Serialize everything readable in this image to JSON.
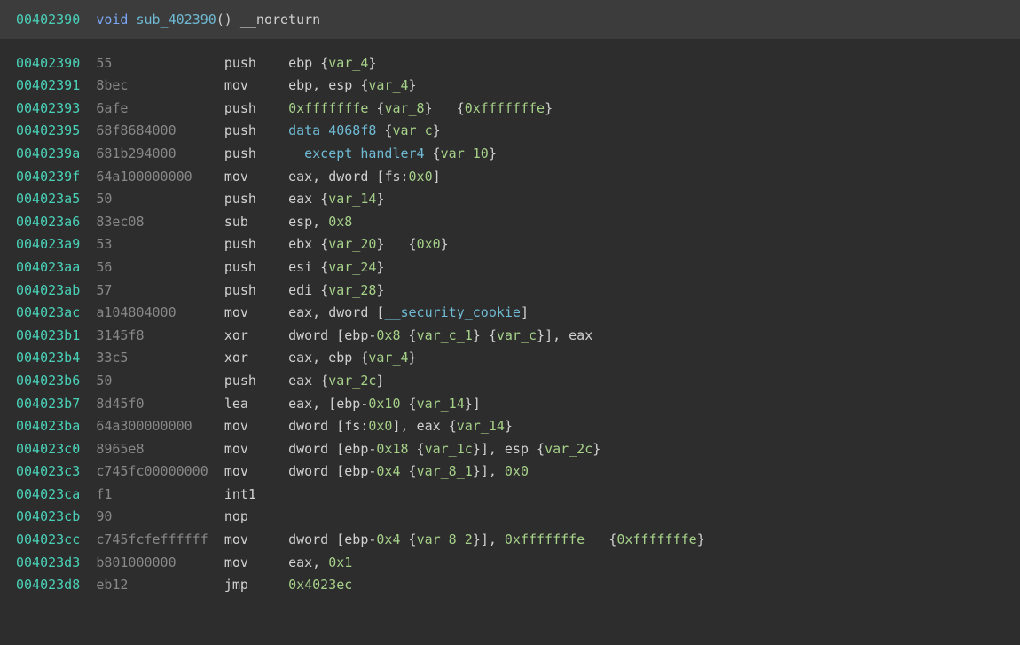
{
  "header": {
    "addr": "00402390",
    "ret_type": "void",
    "name": "sub_402390",
    "parens": "()",
    "attr": "__noreturn"
  },
  "rows": [
    {
      "addr": "00402390",
      "bytes": "55",
      "mnemo": "push",
      "ops": [
        {
          "t": "reg",
          "v": "ebp"
        },
        {
          "t": "sp"
        },
        {
          "t": "brace",
          "v": "{"
        },
        {
          "t": "var",
          "v": "var_4"
        },
        {
          "t": "brace",
          "v": "}"
        }
      ]
    },
    {
      "addr": "00402391",
      "bytes": "8bec",
      "mnemo": "mov",
      "ops": [
        {
          "t": "reg",
          "v": "ebp"
        },
        {
          "t": "punct",
          "v": ", "
        },
        {
          "t": "reg",
          "v": "esp"
        },
        {
          "t": "sp"
        },
        {
          "t": "brace",
          "v": "{"
        },
        {
          "t": "var",
          "v": "var_4"
        },
        {
          "t": "brace",
          "v": "}"
        }
      ]
    },
    {
      "addr": "00402393",
      "bytes": "6afe",
      "mnemo": "push",
      "ops": [
        {
          "t": "num",
          "v": "0xfffffffe"
        },
        {
          "t": "sp"
        },
        {
          "t": "brace",
          "v": "{"
        },
        {
          "t": "var",
          "v": "var_8"
        },
        {
          "t": "brace",
          "v": "}"
        },
        {
          "t": "sp3"
        },
        {
          "t": "brace",
          "v": "{"
        },
        {
          "t": "num",
          "v": "0xfffffffe"
        },
        {
          "t": "brace",
          "v": "}"
        }
      ]
    },
    {
      "addr": "00402395",
      "bytes": "68f8684000",
      "mnemo": "push",
      "ops": [
        {
          "t": "sym",
          "v": "data_4068f8"
        },
        {
          "t": "sp"
        },
        {
          "t": "brace",
          "v": "{"
        },
        {
          "t": "var",
          "v": "var_c"
        },
        {
          "t": "brace",
          "v": "}"
        }
      ]
    },
    {
      "addr": "0040239a",
      "bytes": "681b294000",
      "mnemo": "push",
      "ops": [
        {
          "t": "sym",
          "v": "__except_handler4"
        },
        {
          "t": "sp"
        },
        {
          "t": "brace",
          "v": "{"
        },
        {
          "t": "var",
          "v": "var_10"
        },
        {
          "t": "brace",
          "v": "}"
        }
      ]
    },
    {
      "addr": "0040239f",
      "bytes": "64a100000000",
      "mnemo": "mov",
      "ops": [
        {
          "t": "reg",
          "v": "eax"
        },
        {
          "t": "punct",
          "v": ", "
        },
        {
          "t": "mem",
          "v": "dword "
        },
        {
          "t": "punct",
          "v": "["
        },
        {
          "t": "reg",
          "v": "fs"
        },
        {
          "t": "punct",
          "v": ":"
        },
        {
          "t": "num",
          "v": "0x0"
        },
        {
          "t": "punct",
          "v": "]"
        }
      ]
    },
    {
      "addr": "004023a5",
      "bytes": "50",
      "mnemo": "push",
      "ops": [
        {
          "t": "reg",
          "v": "eax"
        },
        {
          "t": "sp"
        },
        {
          "t": "brace",
          "v": "{"
        },
        {
          "t": "var",
          "v": "var_14"
        },
        {
          "t": "brace",
          "v": "}"
        }
      ]
    },
    {
      "addr": "004023a6",
      "bytes": "83ec08",
      "mnemo": "sub",
      "ops": [
        {
          "t": "reg",
          "v": "esp"
        },
        {
          "t": "punct",
          "v": ", "
        },
        {
          "t": "num",
          "v": "0x8"
        }
      ]
    },
    {
      "addr": "004023a9",
      "bytes": "53",
      "mnemo": "push",
      "ops": [
        {
          "t": "reg",
          "v": "ebx"
        },
        {
          "t": "sp"
        },
        {
          "t": "brace",
          "v": "{"
        },
        {
          "t": "var",
          "v": "var_20"
        },
        {
          "t": "brace",
          "v": "}"
        },
        {
          "t": "sp3"
        },
        {
          "t": "brace",
          "v": "{"
        },
        {
          "t": "num",
          "v": "0x0"
        },
        {
          "t": "brace",
          "v": "}"
        }
      ]
    },
    {
      "addr": "004023aa",
      "bytes": "56",
      "mnemo": "push",
      "ops": [
        {
          "t": "reg",
          "v": "esi"
        },
        {
          "t": "sp"
        },
        {
          "t": "brace",
          "v": "{"
        },
        {
          "t": "var",
          "v": "var_24"
        },
        {
          "t": "brace",
          "v": "}"
        }
      ]
    },
    {
      "addr": "004023ab",
      "bytes": "57",
      "mnemo": "push",
      "ops": [
        {
          "t": "reg",
          "v": "edi"
        },
        {
          "t": "sp"
        },
        {
          "t": "brace",
          "v": "{"
        },
        {
          "t": "var",
          "v": "var_28"
        },
        {
          "t": "brace",
          "v": "}"
        }
      ]
    },
    {
      "addr": "004023ac",
      "bytes": "a104804000",
      "mnemo": "mov",
      "ops": [
        {
          "t": "reg",
          "v": "eax"
        },
        {
          "t": "punct",
          "v": ", "
        },
        {
          "t": "mem",
          "v": "dword "
        },
        {
          "t": "punct",
          "v": "["
        },
        {
          "t": "sym",
          "v": "__security_cookie"
        },
        {
          "t": "punct",
          "v": "]"
        }
      ]
    },
    {
      "addr": "004023b1",
      "bytes": "3145f8",
      "mnemo": "xor",
      "ops": [
        {
          "t": "mem",
          "v": "dword "
        },
        {
          "t": "punct",
          "v": "["
        },
        {
          "t": "reg",
          "v": "ebp"
        },
        {
          "t": "punct",
          "v": "-"
        },
        {
          "t": "num",
          "v": "0x8"
        },
        {
          "t": "sp"
        },
        {
          "t": "brace",
          "v": "{"
        },
        {
          "t": "var",
          "v": "var_c_1"
        },
        {
          "t": "brace",
          "v": "}"
        },
        {
          "t": "sp"
        },
        {
          "t": "brace",
          "v": "{"
        },
        {
          "t": "var",
          "v": "var_c"
        },
        {
          "t": "brace",
          "v": "}"
        },
        {
          "t": "punct",
          "v": "]"
        },
        {
          "t": "punct",
          "v": ", "
        },
        {
          "t": "reg",
          "v": "eax"
        }
      ]
    },
    {
      "addr": "004023b4",
      "bytes": "33c5",
      "mnemo": "xor",
      "ops": [
        {
          "t": "reg",
          "v": "eax"
        },
        {
          "t": "punct",
          "v": ", "
        },
        {
          "t": "reg",
          "v": "ebp"
        },
        {
          "t": "sp"
        },
        {
          "t": "brace",
          "v": "{"
        },
        {
          "t": "var",
          "v": "var_4"
        },
        {
          "t": "brace",
          "v": "}"
        }
      ]
    },
    {
      "addr": "004023b6",
      "bytes": "50",
      "mnemo": "push",
      "ops": [
        {
          "t": "reg",
          "v": "eax"
        },
        {
          "t": "sp"
        },
        {
          "t": "brace",
          "v": "{"
        },
        {
          "t": "var",
          "v": "var_2c"
        },
        {
          "t": "brace",
          "v": "}"
        }
      ]
    },
    {
      "addr": "004023b7",
      "bytes": "8d45f0",
      "mnemo": "lea",
      "ops": [
        {
          "t": "reg",
          "v": "eax"
        },
        {
          "t": "punct",
          "v": ", "
        },
        {
          "t": "punct",
          "v": "["
        },
        {
          "t": "reg",
          "v": "ebp"
        },
        {
          "t": "punct",
          "v": "-"
        },
        {
          "t": "num",
          "v": "0x10"
        },
        {
          "t": "sp"
        },
        {
          "t": "brace",
          "v": "{"
        },
        {
          "t": "var",
          "v": "var_14"
        },
        {
          "t": "brace",
          "v": "}"
        },
        {
          "t": "punct",
          "v": "]"
        }
      ]
    },
    {
      "addr": "004023ba",
      "bytes": "64a300000000",
      "mnemo": "mov",
      "ops": [
        {
          "t": "mem",
          "v": "dword "
        },
        {
          "t": "punct",
          "v": "["
        },
        {
          "t": "reg",
          "v": "fs"
        },
        {
          "t": "punct",
          "v": ":"
        },
        {
          "t": "num",
          "v": "0x0"
        },
        {
          "t": "punct",
          "v": "]"
        },
        {
          "t": "punct",
          "v": ", "
        },
        {
          "t": "reg",
          "v": "eax"
        },
        {
          "t": "sp"
        },
        {
          "t": "brace",
          "v": "{"
        },
        {
          "t": "var",
          "v": "var_14"
        },
        {
          "t": "brace",
          "v": "}"
        }
      ]
    },
    {
      "addr": "004023c0",
      "bytes": "8965e8",
      "mnemo": "mov",
      "ops": [
        {
          "t": "mem",
          "v": "dword "
        },
        {
          "t": "punct",
          "v": "["
        },
        {
          "t": "reg",
          "v": "ebp"
        },
        {
          "t": "punct",
          "v": "-"
        },
        {
          "t": "num",
          "v": "0x18"
        },
        {
          "t": "sp"
        },
        {
          "t": "brace",
          "v": "{"
        },
        {
          "t": "var",
          "v": "var_1c"
        },
        {
          "t": "brace",
          "v": "}"
        },
        {
          "t": "punct",
          "v": "]"
        },
        {
          "t": "punct",
          "v": ", "
        },
        {
          "t": "reg",
          "v": "esp"
        },
        {
          "t": "sp"
        },
        {
          "t": "brace",
          "v": "{"
        },
        {
          "t": "var",
          "v": "var_2c"
        },
        {
          "t": "brace",
          "v": "}"
        }
      ]
    },
    {
      "addr": "004023c3",
      "bytes": "c745fc00000000",
      "mnemo": "mov",
      "ops": [
        {
          "t": "mem",
          "v": "dword "
        },
        {
          "t": "punct",
          "v": "["
        },
        {
          "t": "reg",
          "v": "ebp"
        },
        {
          "t": "punct",
          "v": "-"
        },
        {
          "t": "num",
          "v": "0x4"
        },
        {
          "t": "sp"
        },
        {
          "t": "brace",
          "v": "{"
        },
        {
          "t": "var",
          "v": "var_8_1"
        },
        {
          "t": "brace",
          "v": "}"
        },
        {
          "t": "punct",
          "v": "]"
        },
        {
          "t": "punct",
          "v": ", "
        },
        {
          "t": "num",
          "v": "0x0"
        }
      ]
    },
    {
      "addr": "004023ca",
      "bytes": "f1",
      "mnemo": "int1",
      "ops": []
    },
    {
      "addr": "004023cb",
      "bytes": "90",
      "mnemo": "nop",
      "ops": []
    },
    {
      "addr": "004023cc",
      "bytes": "c745fcfeffffff",
      "mnemo": "mov",
      "ops": [
        {
          "t": "mem",
          "v": "dword "
        },
        {
          "t": "punct",
          "v": "["
        },
        {
          "t": "reg",
          "v": "ebp"
        },
        {
          "t": "punct",
          "v": "-"
        },
        {
          "t": "num",
          "v": "0x4"
        },
        {
          "t": "sp"
        },
        {
          "t": "brace",
          "v": "{"
        },
        {
          "t": "var",
          "v": "var_8_2"
        },
        {
          "t": "brace",
          "v": "}"
        },
        {
          "t": "punct",
          "v": "]"
        },
        {
          "t": "punct",
          "v": ", "
        },
        {
          "t": "num",
          "v": "0xfffffffe"
        },
        {
          "t": "sp3"
        },
        {
          "t": "brace",
          "v": "{"
        },
        {
          "t": "num",
          "v": "0xfffffffe"
        },
        {
          "t": "brace",
          "v": "}"
        }
      ]
    },
    {
      "addr": "004023d3",
      "bytes": "b801000000",
      "mnemo": "mov",
      "ops": [
        {
          "t": "reg",
          "v": "eax"
        },
        {
          "t": "punct",
          "v": ", "
        },
        {
          "t": "num",
          "v": "0x1"
        }
      ]
    },
    {
      "addr": "004023d8",
      "bytes": "eb12",
      "mnemo": "jmp",
      "ops": [
        {
          "t": "num",
          "v": "0x4023ec"
        }
      ]
    }
  ],
  "columns": {
    "addr_w": 10,
    "bytes_w": 16,
    "mnemo_w": 8
  }
}
